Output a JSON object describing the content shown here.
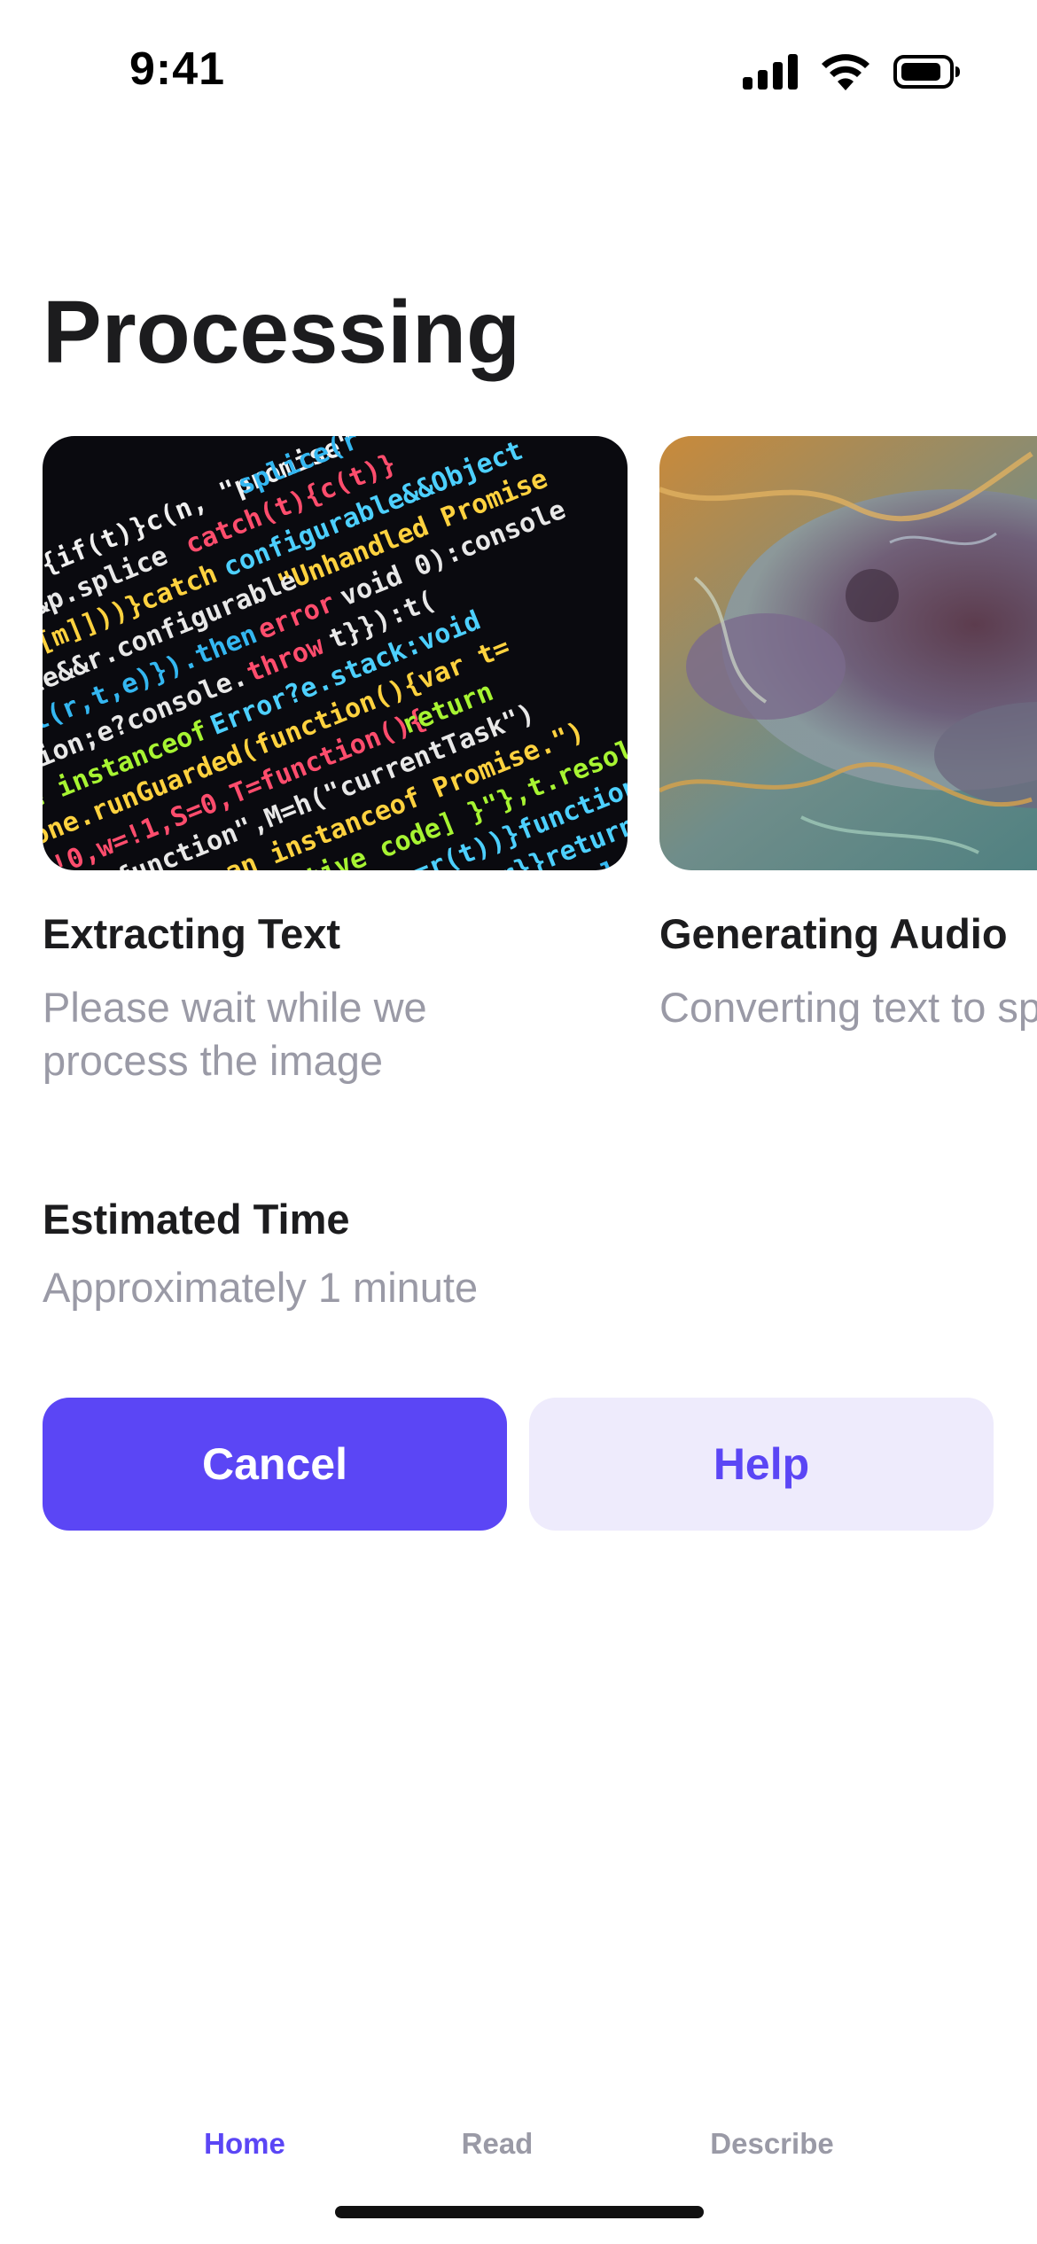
{
  "status_bar": {
    "time": "9:41",
    "icons": [
      "cellular-signal-icon",
      "wifi-icon",
      "battery-icon"
    ]
  },
  "page": {
    "title": "Processing"
  },
  "cards": [
    {
      "title": "Extracting Text",
      "subtitle": "Please wait while we process the image",
      "image": "source-code-photo"
    },
    {
      "title": "Generating Audio",
      "subtitle": "Converting text to speech",
      "image": "satellite-terrain-photo"
    }
  ],
  "estimate": {
    "label": "Estimated Time",
    "value": "Approximately 1 minute"
  },
  "buttons": {
    "cancel_label": "Cancel",
    "help_label": "Help"
  },
  "tabs": [
    {
      "label": "Home",
      "active": true
    },
    {
      "label": "Read",
      "active": false
    },
    {
      "label": "Describe",
      "active": false
    }
  ],
  "colors": {
    "accent": "#5b46f5",
    "accent_light": "#eeebfc",
    "secondary_text": "#9a9aa6",
    "primary_text": "#1c1c1e"
  }
}
